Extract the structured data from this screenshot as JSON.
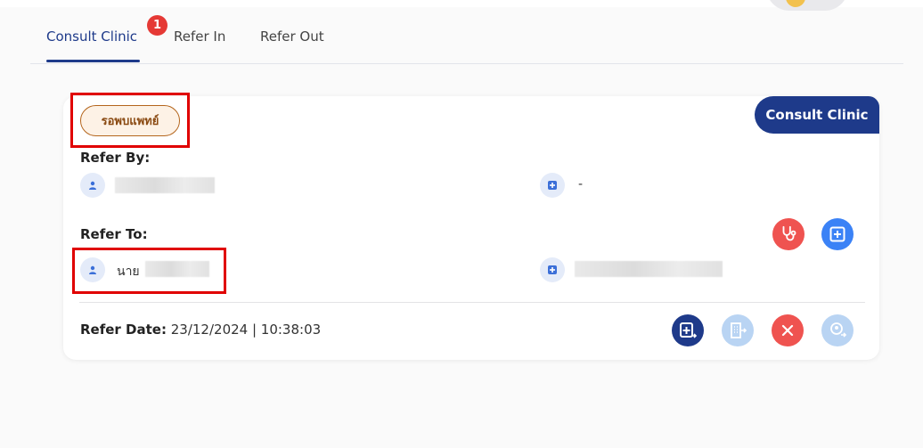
{
  "tabs": [
    {
      "label": "Consult Clinic",
      "active": true,
      "badge": "1"
    },
    {
      "label": "Refer In",
      "active": false
    },
    {
      "label": "Refer Out",
      "active": false
    }
  ],
  "card": {
    "corner_tag": "Consult Clinic",
    "status": "รอพบแพทย์",
    "refer_by": {
      "label": "Refer By:",
      "hospital_value": "-"
    },
    "refer_to": {
      "label": "Refer To:",
      "person_prefix": "นาย"
    },
    "refer_date": {
      "label": "Refer Date:",
      "value": "23/12/2024 | 10:38:03"
    }
  },
  "colors": {
    "accent": "#1e3a8a",
    "badge": "#e53935",
    "status_border": "#b4651c",
    "btn_red": "#ef5350",
    "btn_blue": "#3b82f6",
    "btn_light_blue": "#b9d4f3",
    "highlight": "#e00000"
  },
  "icons": {
    "person": "person-icon",
    "hospital": "hospital-plus-icon",
    "stethoscope": "stethoscope-icon",
    "add": "plus-square-icon",
    "transfer": "transfer-in-icon",
    "building": "building-arrow-icon",
    "cancel": "close-icon",
    "doctor": "doctor-arrow-icon"
  }
}
